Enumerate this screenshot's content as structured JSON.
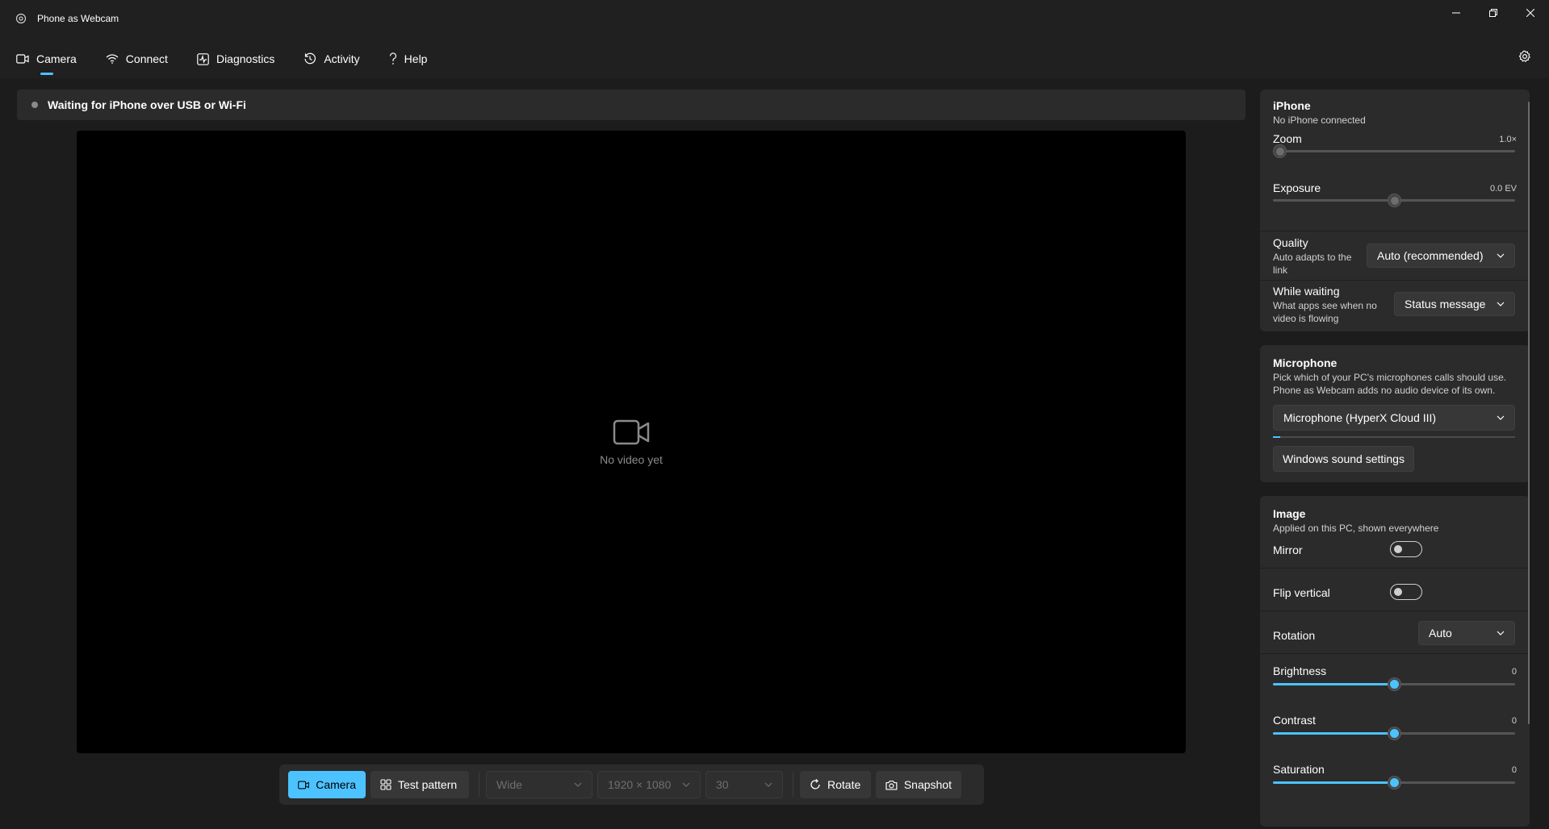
{
  "app": {
    "title": "Phone as Webcam"
  },
  "nav": {
    "tabs": [
      {
        "label": "Camera",
        "icon": "camera-icon"
      },
      {
        "label": "Connect",
        "icon": "wifi-icon"
      },
      {
        "label": "Diagnostics",
        "icon": "pulse-icon"
      },
      {
        "label": "Activity",
        "icon": "history-icon"
      },
      {
        "label": "Help",
        "icon": "question-icon"
      }
    ]
  },
  "status": {
    "text": "Waiting for iPhone over USB or Wi-Fi"
  },
  "video": {
    "placeholder": "No video yet"
  },
  "toolbar": {
    "camera_label": "Camera",
    "test_pattern_label": "Test pattern",
    "lens": "Wide",
    "resolution": "1920 × 1080",
    "fps": "30",
    "rotate_label": "Rotate",
    "snapshot_label": "Snapshot"
  },
  "iphone": {
    "title": "iPhone",
    "subtitle": "No iPhone connected",
    "zoom_label": "Zoom",
    "zoom_value": "1.0×",
    "zoom_fraction": 0.0,
    "exposure_label": "Exposure",
    "exposure_value": "0.0 EV",
    "exposure_fraction": 0.5,
    "quality_label": "Quality",
    "quality_sub_1": "Auto adapts to the",
    "quality_sub_2": "link",
    "quality_value": "Auto (recommended)",
    "waiting_label": "While waiting",
    "waiting_sub_1": "What apps see when no",
    "waiting_sub_2": "video is flowing",
    "waiting_value": "Status message"
  },
  "microphone": {
    "title": "Microphone",
    "sub_1": "Pick which of your PC's microphones calls should use.",
    "sub_2": "Phone as Webcam adds no audio device of its own.",
    "device": "Microphone (HyperX Cloud III)",
    "level_fraction": 0.03,
    "sound_settings_label": "Windows sound settings"
  },
  "image": {
    "title": "Image",
    "subtitle": "Applied on this PC, shown everywhere",
    "mirror_label": "Mirror",
    "mirror_on": false,
    "flip_label": "Flip vertical",
    "flip_on": false,
    "rotation_label": "Rotation",
    "rotation_value": "Auto",
    "brightness_label": "Brightness",
    "brightness_value": "0",
    "contrast_label": "Contrast",
    "contrast_value": "0",
    "saturation_label": "Saturation",
    "saturation_value": "0"
  },
  "colors": {
    "accent": "#4cc2ff",
    "background": "#202020",
    "card": "#2b2b2b"
  }
}
